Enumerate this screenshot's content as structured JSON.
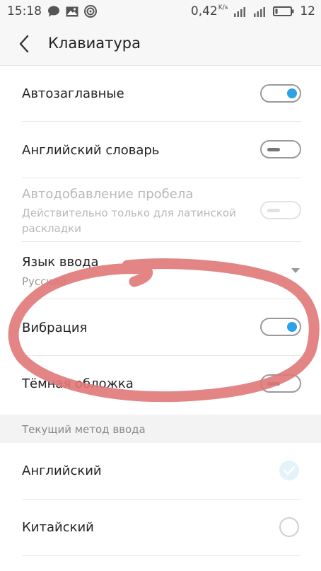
{
  "status_bar": {
    "time": "15:18",
    "left_icons": [
      "chat-bubble-icon",
      "image-icon",
      "hotspot-icon"
    ],
    "speed": "0,42",
    "speed_unit": "K/s",
    "battery": "12"
  },
  "header": {
    "title": "Клавиатура"
  },
  "settings": {
    "auto_caps": {
      "label": "Автозаглавные",
      "on": true
    },
    "english_dict": {
      "label": "Английский словарь",
      "on": false
    },
    "auto_space": {
      "label": "Автодобавление пробела",
      "sublabel": "Действительно только для латинской раскладки",
      "on": false,
      "disabled": true
    },
    "input_language": {
      "label": "Язык ввода",
      "value": "Русский"
    },
    "vibration": {
      "label": "Вибрация",
      "on": true
    },
    "dark_skin": {
      "label": "Тёмная обложка",
      "on": false
    }
  },
  "section": {
    "title": "Текущий метод ввода"
  },
  "methods": [
    {
      "label": "Английский",
      "selected": true
    },
    {
      "label": "Китайский",
      "selected": false
    }
  ],
  "colors": {
    "accent": "#2ea2e6",
    "annotation": "#e06d6d"
  }
}
